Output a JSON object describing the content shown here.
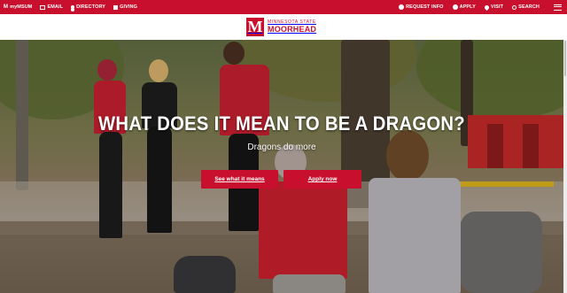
{
  "topbar": {
    "left": [
      {
        "label": "myMSUM",
        "icon": "msum-logo-icon"
      },
      {
        "label": "EMAIL",
        "icon": "envelope-icon"
      },
      {
        "label": "DIRECTORY",
        "icon": "person-icon"
      },
      {
        "label": "GIVING",
        "icon": "gift-icon"
      }
    ],
    "right": [
      {
        "label": "REQUEST INFO",
        "icon": "info-icon"
      },
      {
        "label": "APPLY",
        "icon": "check-circle-icon"
      },
      {
        "label": "VISIT",
        "icon": "map-pin-icon"
      },
      {
        "label": "SEARCH",
        "icon": "search-icon"
      }
    ]
  },
  "logo": {
    "mark": "M",
    "top": "MINNESOTA STATE",
    "bottom": "MOORHEAD"
  },
  "hero": {
    "headline": "WHAT DOES IT MEAN TO BE A DRAGON?",
    "subhead": "Dragons do more",
    "buttons": {
      "see": "See what it means",
      "apply": "Apply now"
    }
  },
  "colors": {
    "brand_red": "#c8102e",
    "white": "#ffffff"
  }
}
